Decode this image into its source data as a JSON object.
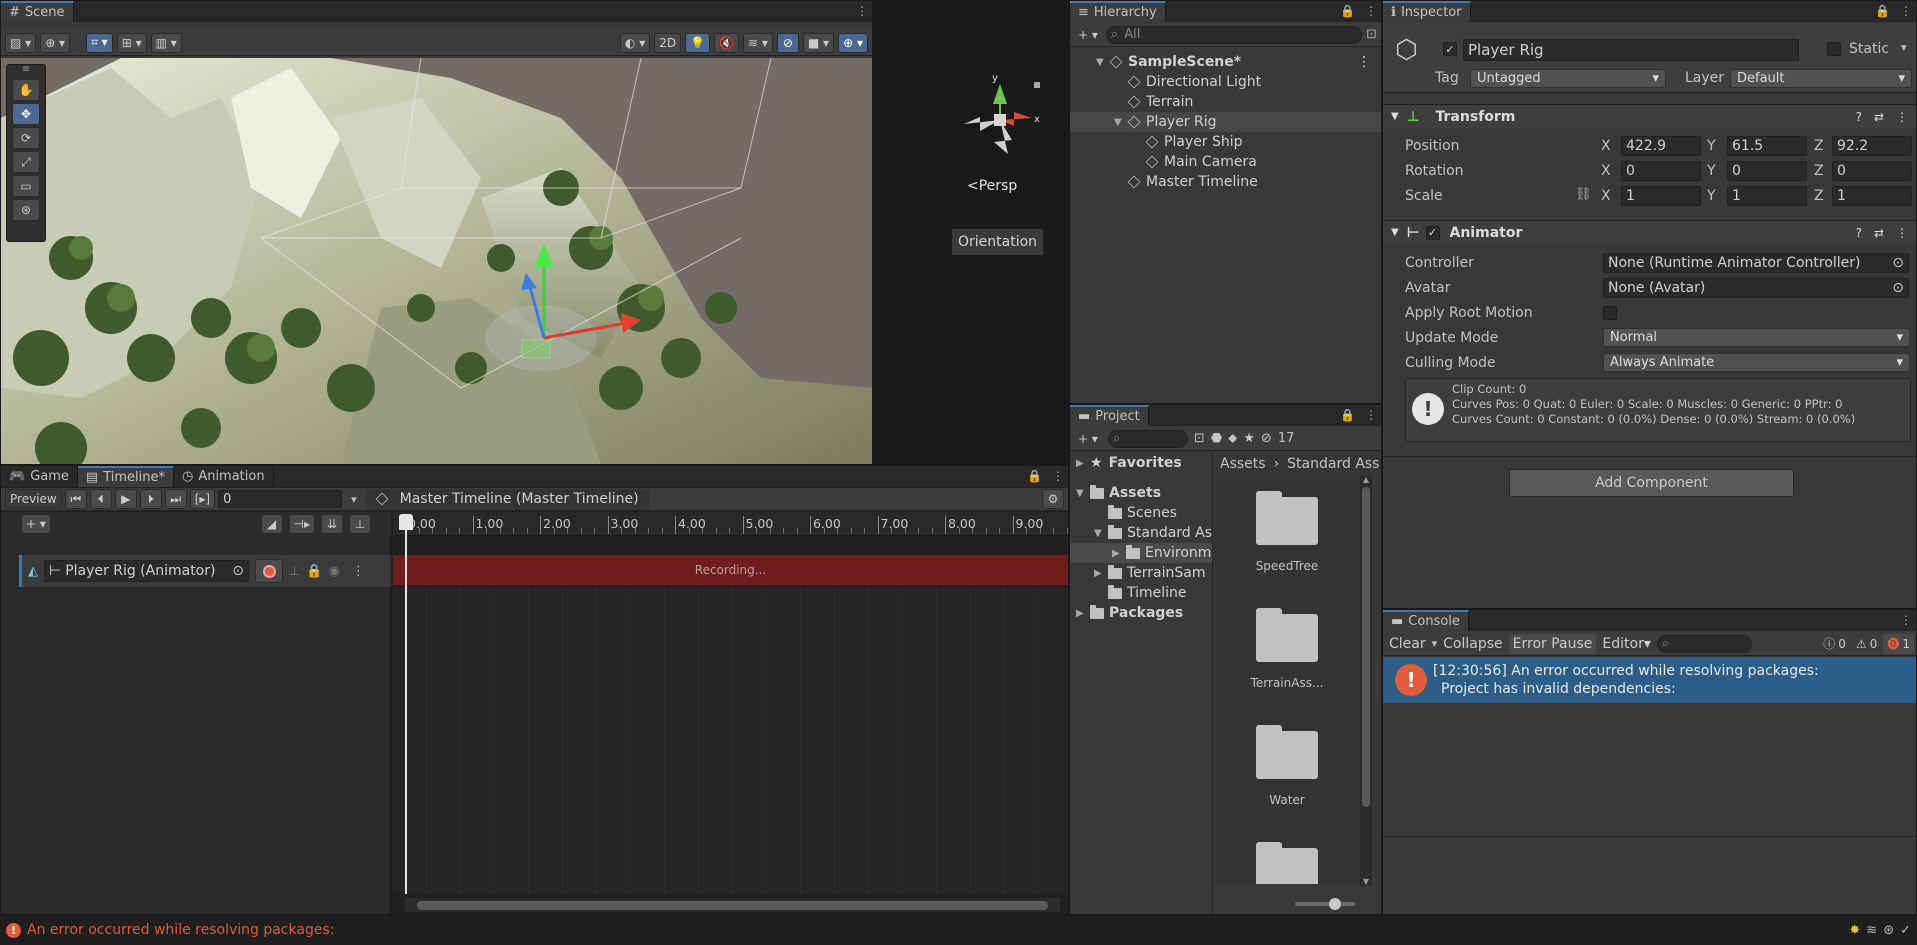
{
  "scene": {
    "tab": "Scene",
    "btn_2d": "2D",
    "persp_label": "<Persp",
    "gizmo_axes": {
      "x": "x",
      "y": "y"
    },
    "tooltip": "Orientation"
  },
  "hierarchy": {
    "tab": "Hierarchy",
    "search_placeholder": "All",
    "items": [
      {
        "label": "SampleScene*",
        "depth": 0,
        "expanded": true,
        "kind": "scene"
      },
      {
        "label": "Directional Light",
        "depth": 1,
        "kind": "object"
      },
      {
        "label": "Terrain",
        "depth": 1,
        "kind": "object"
      },
      {
        "label": "Player Rig",
        "depth": 1,
        "expanded": true,
        "kind": "object",
        "selected": true
      },
      {
        "label": "Player Ship",
        "depth": 2,
        "kind": "object"
      },
      {
        "label": "Main Camera",
        "depth": 2,
        "kind": "object"
      },
      {
        "label": "Master Timeline",
        "depth": 1,
        "kind": "object"
      }
    ]
  },
  "inspector": {
    "tab": "Inspector",
    "object_name": "Player Rig",
    "static_label": "Static",
    "tag_label": "Tag",
    "tag_value": "Untagged",
    "layer_label": "Layer",
    "layer_value": "Default",
    "transform": {
      "title": "Transform",
      "position_label": "Position",
      "rotation_label": "Rotation",
      "scale_label": "Scale",
      "position": {
        "x": "422.9",
        "y": "61.5",
        "z": "92.2"
      },
      "rotation": {
        "x": "0",
        "y": "0",
        "z": "0"
      },
      "scale": {
        "x": "1",
        "y": "1",
        "z": "1"
      },
      "axis": {
        "x": "X",
        "y": "Y",
        "z": "Z"
      }
    },
    "animator": {
      "title": "Animator",
      "controller_label": "Controller",
      "controller_value": "None (Runtime Animator Controller)",
      "avatar_label": "Avatar",
      "avatar_value": "None (Avatar)",
      "root_motion_label": "Apply Root Motion",
      "update_mode_label": "Update Mode",
      "update_mode_value": "Normal",
      "culling_mode_label": "Culling Mode",
      "culling_mode_value": "Always Animate",
      "info_line1": "Clip Count: 0",
      "info_line2": "Curves Pos: 0 Quat: 0 Euler: 0 Scale: 0 Muscles: 0 Generic: 0 PPtr: 0",
      "info_line3": "Curves Count: 0 Constant: 0 (0.0%) Dense: 0 (0.0%) Stream: 0 (0.0%)"
    },
    "add_component": "Add Component"
  },
  "bottom_tabs": {
    "game": "Game",
    "timeline": "Timeline*",
    "animation": "Animation"
  },
  "timeline": {
    "preview": "Preview",
    "frame": "0",
    "asset_path": "Master Timeline (Master Timeline)",
    "ruler_ticks": [
      "0.00",
      "1.00",
      "2.00",
      "3.00",
      "4.00",
      "5.00",
      "6.00",
      "7.00",
      "8.00",
      "9.00"
    ],
    "track_label": "Player Rig (Animator)",
    "recording": "Recording..."
  },
  "project": {
    "tab": "Project",
    "hidden_count": "17",
    "tree": [
      {
        "label": "Favorites",
        "depth": 0,
        "kind": "star",
        "bold": true
      },
      {
        "label": "Assets",
        "depth": 0,
        "kind": "folder",
        "bold": true,
        "expanded": true
      },
      {
        "label": "Scenes",
        "depth": 1,
        "kind": "folder"
      },
      {
        "label": "Standard As",
        "depth": 1,
        "kind": "folder",
        "expanded": true
      },
      {
        "label": "Environm",
        "depth": 2,
        "kind": "folder",
        "selected": true
      },
      {
        "label": "TerrainSam",
        "depth": 1,
        "kind": "folder"
      },
      {
        "label": "Timeline",
        "depth": 1,
        "kind": "folder"
      },
      {
        "label": "Packages",
        "depth": 0,
        "kind": "folder",
        "bold": true
      }
    ],
    "breadcrumb": [
      "Assets",
      "Standard Ass"
    ],
    "assets": [
      "SpeedTree",
      "TerrainAss...",
      "Water"
    ]
  },
  "console": {
    "tab": "Console",
    "clear": "Clear",
    "collapse": "Collapse",
    "error_pause": "Error Pause",
    "editor": "Editor",
    "counts": {
      "log": "0",
      "warn": "0",
      "error": "1"
    },
    "message_line1": "[12:30:56] An error occurred while resolving packages:",
    "message_line2": "Project has invalid dependencies:"
  },
  "status_bar": {
    "message": "An error occurred while resolving packages:"
  },
  "colors": {
    "accent": "#3a79bb",
    "selection": "#2c5d87",
    "error": "#e05c3b",
    "recording": "#6e1c1c"
  }
}
